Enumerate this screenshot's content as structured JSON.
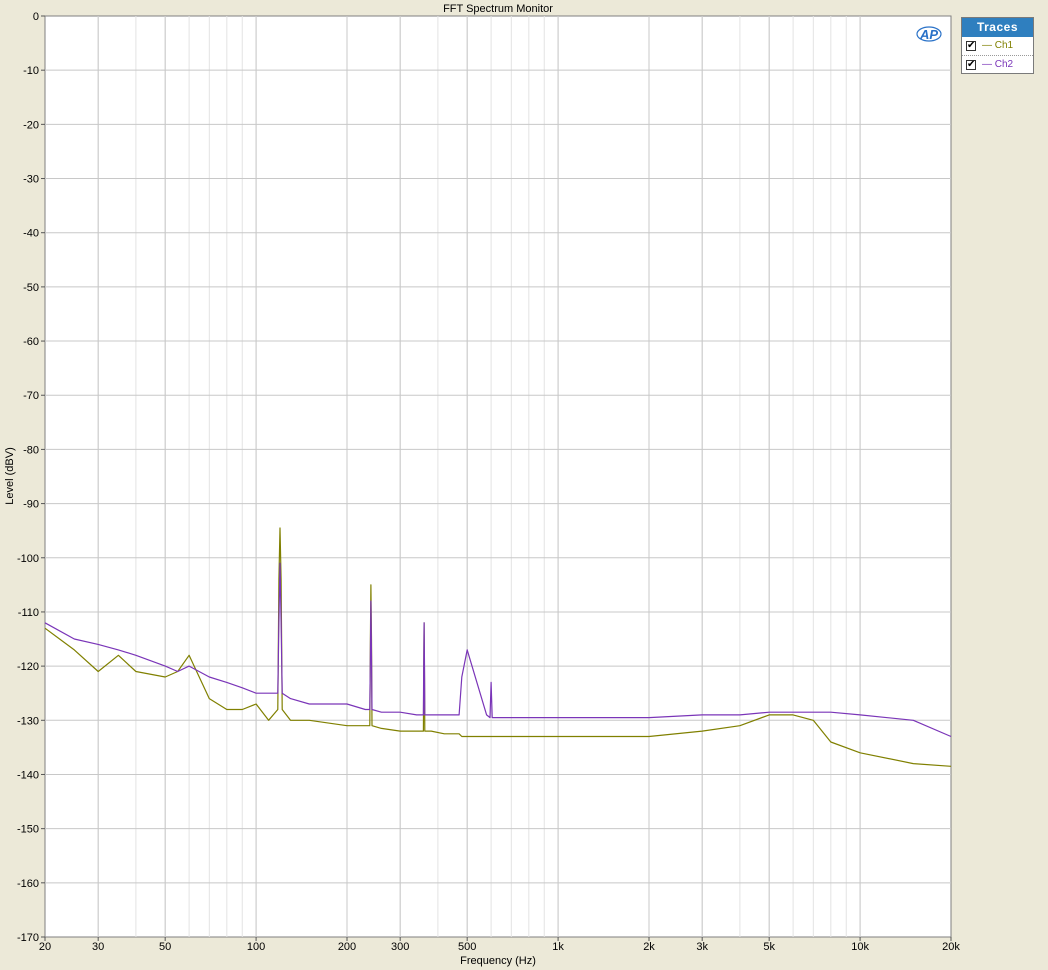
{
  "chart_data": {
    "type": "line",
    "title": "FFT Spectrum Monitor",
    "xlabel": "Frequency (Hz)",
    "ylabel": "Level (dBV)",
    "xscale": "log",
    "xlim": [
      20,
      20000
    ],
    "ylim": [
      -170,
      0
    ],
    "grid": true,
    "x_ticks": [
      20,
      30,
      50,
      100,
      200,
      300,
      500,
      1000,
      2000,
      3000,
      5000,
      10000,
      20000
    ],
    "x_tick_labels": [
      "20",
      "30",
      "50",
      "100",
      "200",
      "300",
      "500",
      "1k",
      "2k",
      "3k",
      "5k",
      "10k",
      "20k"
    ],
    "y_ticks": [
      0,
      -10,
      -20,
      -30,
      -40,
      -50,
      -60,
      -70,
      -80,
      -90,
      -100,
      -110,
      -120,
      -130,
      -140,
      -150,
      -160,
      -170
    ],
    "series": [
      {
        "name": "Ch1",
        "color": "#808000",
        "x": [
          20,
          25,
          30,
          35,
          40,
          50,
          55,
          60,
          70,
          80,
          90,
          100,
          110,
          118,
          119,
          120,
          121,
          122,
          130,
          150,
          200,
          230,
          238,
          239,
          240,
          241,
          242,
          260,
          300,
          340,
          358,
          359,
          360,
          361,
          362,
          380,
          420,
          470,
          480,
          500,
          600,
          800,
          1000,
          1500,
          2000,
          3000,
          4000,
          5000,
          6000,
          7000,
          8000,
          10000,
          15000,
          20000
        ],
        "y": [
          -113,
          -117,
          -121,
          -118,
          -121,
          -122,
          -121,
          -118,
          -126,
          -128,
          -128,
          -127,
          -130,
          -128,
          -104,
          -94.5,
          -104,
          -128,
          -130,
          -130,
          -131,
          -131,
          -131,
          -115,
          -105,
          -115,
          -131,
          -131.5,
          -132,
          -132,
          -132,
          -122,
          -112,
          -122,
          -132,
          -132,
          -132.5,
          -132.5,
          -133,
          -133,
          -133,
          -133,
          -133,
          -133,
          -133,
          -132,
          -131,
          -129,
          -129,
          -130,
          -134,
          -136,
          -138,
          -138.5
        ]
      },
      {
        "name": "Ch2",
        "color": "#7a35b8",
        "x": [
          20,
          25,
          30,
          35,
          40,
          50,
          55,
          60,
          70,
          80,
          90,
          100,
          110,
          118,
          119,
          120,
          121,
          122,
          130,
          150,
          200,
          230,
          238,
          239,
          240,
          241,
          242,
          260,
          300,
          340,
          358,
          359,
          360,
          361,
          362,
          380,
          420,
          470,
          480,
          500,
          580,
          595,
          600,
          605,
          620,
          800,
          1000,
          1500,
          2000,
          3000,
          4000,
          5000,
          6000,
          7000,
          8000,
          10000,
          15000,
          20000
        ],
        "y": [
          -112,
          -115,
          -116,
          -117,
          -118,
          -120,
          -121,
          -120,
          -122,
          -123,
          -124,
          -125,
          -125,
          -125,
          -112,
          -101,
          -112,
          -125,
          -126,
          -127,
          -127,
          -128,
          -128,
          -118,
          -108,
          -118,
          -128,
          -128.5,
          -128.5,
          -129,
          -129,
          -120,
          -112,
          -120,
          -129,
          -129,
          -129,
          -129,
          -122,
          -117,
          -129,
          -129.5,
          -123,
          -129.5,
          -129.5,
          -129.5,
          -129.5,
          -129.5,
          -129.5,
          -129,
          -129,
          -128.5,
          -128.5,
          -128.5,
          -128.5,
          -129,
          -130,
          -133
        ]
      }
    ]
  },
  "legend": {
    "title": "Traces",
    "items": [
      {
        "label": "— Ch1",
        "color": "#808000",
        "checked": true
      },
      {
        "label": "— Ch2",
        "color": "#7a35b8",
        "checked": true
      }
    ],
    "check_glyph": "✔"
  },
  "logo": "AP"
}
